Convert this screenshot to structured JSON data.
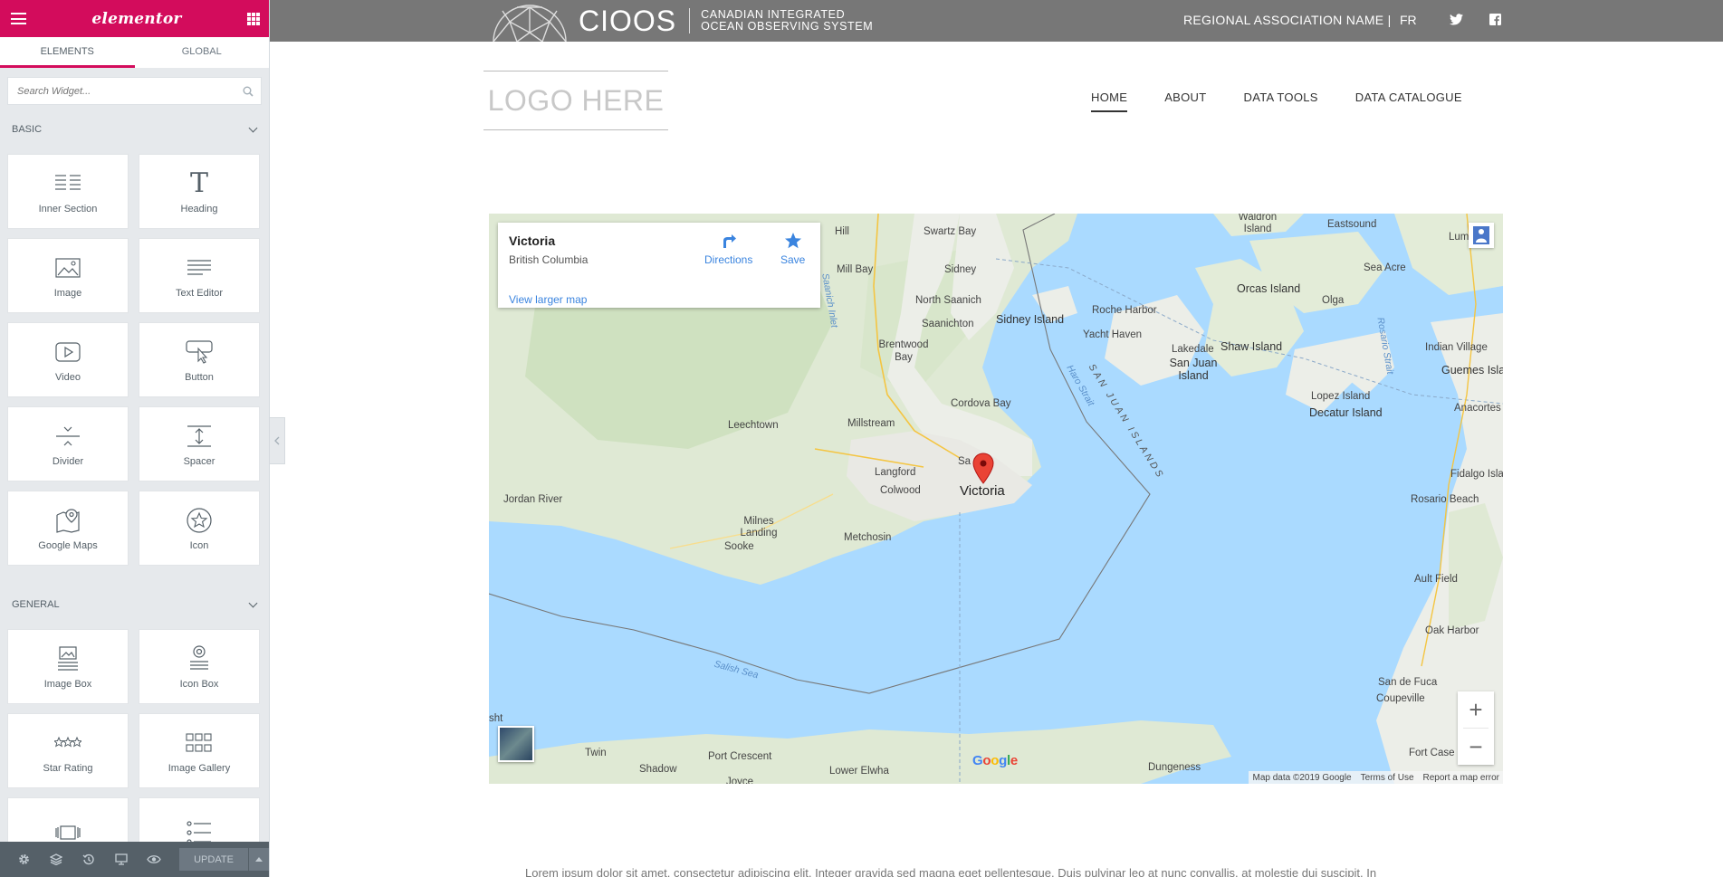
{
  "panel": {
    "brand": "elementor",
    "tabs": [
      {
        "label": "ELEMENTS"
      },
      {
        "label": "GLOBAL"
      }
    ],
    "search": {
      "placeholder": "Search Widget..."
    },
    "categories": [
      {
        "title": "BASIC"
      },
      {
        "title": "GENERAL"
      }
    ],
    "basic_widgets": [
      {
        "label": "Inner Section",
        "icon": "inner-section-icon"
      },
      {
        "label": "Heading",
        "icon": "heading-icon"
      },
      {
        "label": "Image",
        "icon": "image-icon"
      },
      {
        "label": "Text Editor",
        "icon": "text-editor-icon"
      },
      {
        "label": "Video",
        "icon": "video-icon"
      },
      {
        "label": "Button",
        "icon": "button-icon"
      },
      {
        "label": "Divider",
        "icon": "divider-icon"
      },
      {
        "label": "Spacer",
        "icon": "spacer-icon"
      },
      {
        "label": "Google Maps",
        "icon": "google-maps-icon"
      },
      {
        "label": "Icon",
        "icon": "star-circle-icon"
      }
    ],
    "general_widgets": [
      {
        "label": "Image Box",
        "icon": "image-box-icon"
      },
      {
        "label": "Icon Box",
        "icon": "icon-box-icon"
      },
      {
        "label": "Star Rating",
        "icon": "star-rating-icon"
      },
      {
        "label": "Image Gallery",
        "icon": "image-gallery-icon"
      },
      {
        "label": "",
        "icon": "carousel-icon"
      },
      {
        "label": "",
        "icon": "icon-list-icon"
      }
    ],
    "footer": {
      "update_label": "UPDATE"
    },
    "colors": {
      "accent": "#d30c5c",
      "panel_bg": "#e6e9ec",
      "footer_bg": "#556068"
    }
  },
  "site": {
    "topbar": {
      "logo_big": "CIOOS",
      "logo_line1": "CANADIAN INTEGRATED",
      "logo_line2": "OCEAN OBSERVING SYSTEM",
      "regional": "REGIONAL ASSOCIATION NAME |",
      "lang": "FR"
    },
    "logo_placeholder": "LOGO HERE",
    "nav": [
      {
        "label": "HOME",
        "active": true
      },
      {
        "label": "ABOUT"
      },
      {
        "label": "DATA TOOLS"
      },
      {
        "label": "DATA CATALOGUE"
      }
    ],
    "lorem": "Lorem ipsum dolor sit amet, consectetur adipiscing elit. Integer gravida sed magna eget pellentesque. Duis pulvinar leo at nunc convallis, at molestie dui suscipit. In"
  },
  "map": {
    "infocard": {
      "title": "Victoria",
      "subtitle": "British Columbia",
      "link": "View larger map",
      "directions": "Directions",
      "save": "Save"
    },
    "marker_label": "Victoria",
    "places": [
      "Waldron Island",
      "Eastsound",
      "Lummi Is",
      "Swartz Bay",
      "Sidney",
      "Mill Bay",
      "Saanich Inlet",
      "North Saanich",
      "Saanichton",
      "Sidney Island",
      "Orcas Island",
      "Olga",
      "Sea Acre",
      "Roche Harbor",
      "Yacht Haven",
      "Lakedale",
      "San Juan Island",
      "Shaw Island",
      "Indian Village",
      "Brentwood Bay",
      "Cordova Bay",
      "Lopez Island",
      "Decatur Island",
      "Guemes Islan",
      "Anacortes",
      "Leechtown",
      "Millstream",
      "Langford",
      "Colwood",
      "Jordan River",
      "Milnes Landing",
      "Sooke",
      "Metchosin",
      "Fidalgo Isla",
      "Rosario Beach",
      "Ault Field",
      "Oak Harbor",
      "San de Fuca",
      "Coupeville",
      "Fort Case",
      "Twin",
      "Port Crescent",
      "Shadow",
      "Lower Elwha",
      "Joyce",
      "Dungeness",
      "Hill",
      "Haro Strait",
      "SAN JUAN ISLANDS",
      "Rosario Strait",
      "Salish Sea",
      "Sa"
    ],
    "google": "Google",
    "attribution": [
      "Map data ©2019 Google",
      "Terms of Use",
      "Report a map error"
    ],
    "zoom_in": "+",
    "zoom_out": "−"
  }
}
